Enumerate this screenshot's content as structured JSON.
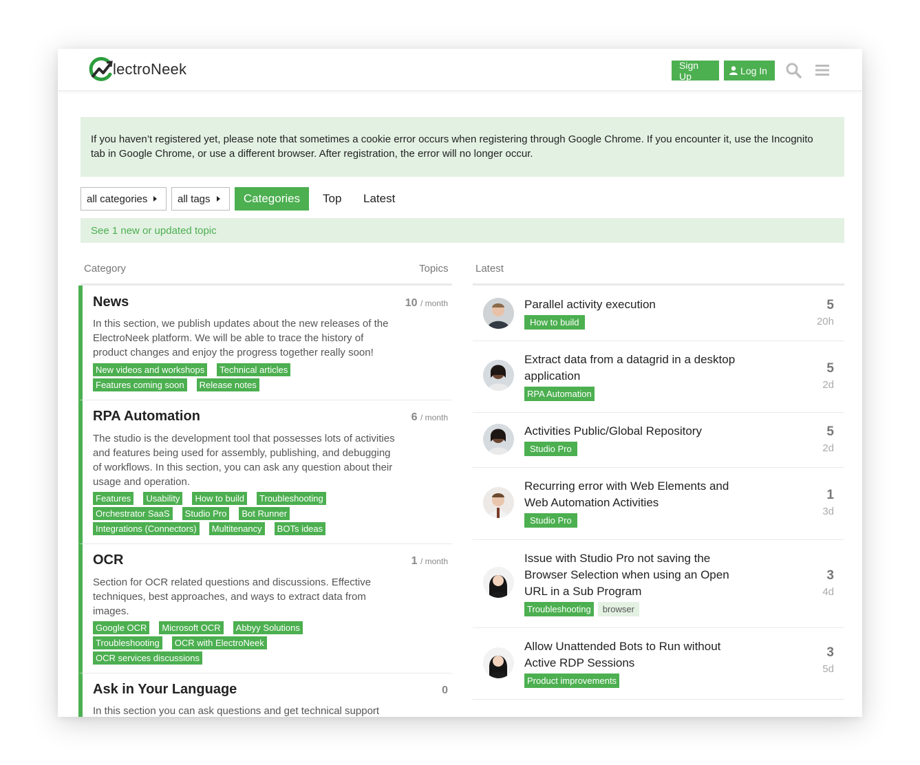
{
  "header": {
    "logo_text": "lectroNeek",
    "signup_label": "Sign Up",
    "login_label": "Log In"
  },
  "banner": {
    "text": "If you haven’t registered yet, please note that sometimes a cookie error occurs when registering through Google Chrome. If you encounter it, use the Incognito tab in Google Chrome, or use a different browser. After registration, the error will no longer occur."
  },
  "nav": {
    "categories_dropdown": "all categories",
    "tags_dropdown": "all tags",
    "tabs": [
      "Categories",
      "Top",
      "Latest"
    ]
  },
  "new_topics_bar": "See 1 new or updated topic",
  "columns": {
    "category": "Category",
    "topics": "Topics",
    "latest": "Latest"
  },
  "categories": [
    {
      "title": "News",
      "count": "10",
      "per": "/ month",
      "desc": "In this section, we publish updates about the new releases of the ElectroNeek platform. We will be able to trace the history of product changes and enjoy the progress together really soon!",
      "tags": [
        [
          "New videos and workshops",
          "Technical articles"
        ],
        [
          "Features coming soon",
          "Release notes"
        ]
      ]
    },
    {
      "title": "RPA Automation",
      "count": "6",
      "per": "/ month",
      "desc": "The studio is the development tool that possesses lots of activities and features being used for assembly, publishing, and debugging of workflows. In this section, you can ask any question about their usage and operation.",
      "tags": [
        [
          "Features",
          "Usability",
          "How to build",
          "Troubleshooting"
        ],
        [
          "Orchestrator SaaS",
          "Studio Pro",
          "Bot Runner"
        ],
        [
          "Integrations (Connectors)",
          "Multitenancy",
          "BOTs ideas"
        ]
      ]
    },
    {
      "title": "OCR",
      "count": "1",
      "per": "/ month",
      "desc": "Section for OCR related questions and discussions. Effective techniques, best approaches, and ways to extract data from images.",
      "tags": [
        [
          "Google OCR",
          "Microsoft OCR",
          "Abbyy Solutions"
        ],
        [
          "Troubleshooting",
          "OCR with ElectroNeek"
        ],
        [
          "OCR services discussions"
        ]
      ]
    },
    {
      "title": "Ask in Your Language",
      "count": "0",
      "desc": "In this section you can ask questions and get technical support"
    }
  ],
  "latest": [
    {
      "title": "Parallel activity execution",
      "tags": [
        "How to build"
      ],
      "replies": "5",
      "age": "20h"
    },
    {
      "title": "Extract data from a datagrid in a desktop application",
      "tags": [
        "RPA Automation"
      ],
      "replies": "5",
      "age": "2d"
    },
    {
      "title": "Activities Public/Global Repository",
      "tags": [
        "Studio Pro"
      ],
      "replies": "5",
      "age": "2d"
    },
    {
      "title": "Recurring error with Web Elements and Web Automation Activities",
      "tags": [
        "Studio Pro"
      ],
      "replies": "1",
      "age": "3d"
    },
    {
      "title": "Issue with Studio Pro not saving the Browser Selection when using an Open URL in a Sub Program",
      "tags": [
        "Troubleshooting"
      ],
      "plain_tag": "browser",
      "replies": "3",
      "age": "4d"
    },
    {
      "title": "Allow Unattended Bots to Run without Active RDP Sessions",
      "tags": [
        "Product improvements"
      ],
      "replies": "3",
      "age": "5d"
    }
  ],
  "colors": {
    "accent": "#4caf50",
    "banner_bg": "#e3f1e3"
  }
}
